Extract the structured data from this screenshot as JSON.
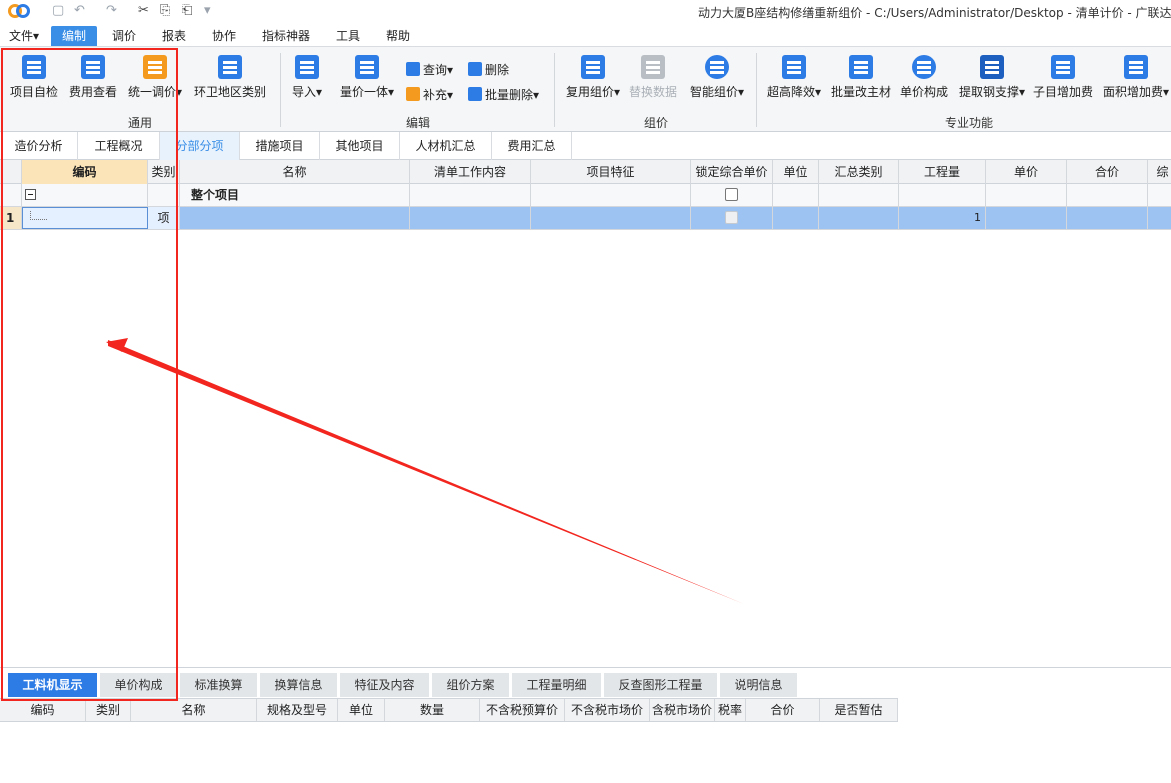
{
  "window": {
    "title": "动力大厦B座结构修缮重新组价 - C:/Users/Administrator/Desktop - 清单计价 - 广联达"
  },
  "quick_access": [
    "▢",
    "↶",
    "↷",
    "✂",
    "⎘",
    "⎗",
    "▾"
  ],
  "menu": [
    {
      "label": "文件▾"
    },
    {
      "label": "编制"
    },
    {
      "label": "调价"
    },
    {
      "label": "报表"
    },
    {
      "label": "协作"
    },
    {
      "label": "指标神器"
    },
    {
      "label": "工具"
    },
    {
      "label": "帮助"
    }
  ],
  "ribbon": {
    "groups": [
      {
        "label": "通用"
      },
      {
        "label": "编辑"
      },
      {
        "label": "组价"
      },
      {
        "label": "专业功能"
      }
    ],
    "buttons": {
      "xmzj": "项目自检",
      "fycx": "费用查看",
      "tytj": "统一调价▾",
      "hwdqlb": "环卫地区类别",
      "daoru": "导入▾",
      "ljyt": "量价一体▾",
      "chaxun": "查询▾",
      "buchong": "补充▾",
      "shanchu": "删除",
      "plsc": "批量删除▾",
      "fyzj": "复用组价▾",
      "thsj": "替换数据",
      "znzj": "智能组价▾",
      "cgjx": "超高降效▾",
      "plgzc": "批量改主材",
      "djgc": "单价构成",
      "tqgzc": "提取钢支撑▾",
      "zmzjf": "子目增加费",
      "mjzjf": "面积增加费▾"
    }
  },
  "tabs": [
    "造价分析",
    "工程概况",
    "分部分项",
    "措施项目",
    "其他项目",
    "人材机汇总",
    "费用汇总"
  ],
  "grid": {
    "columns": [
      "编码",
      "类别",
      "名称",
      "清单工作内容",
      "项目特征",
      "锁定综合单价",
      "单位",
      "汇总类别",
      "工程量",
      "单价",
      "合价",
      "综"
    ],
    "rows": [
      {
        "index": "",
        "code": "",
        "type": "",
        "name": "整个项目",
        "quantity": ""
      },
      {
        "index": "1",
        "code": "",
        "type": "项",
        "name": "",
        "quantity": "1"
      }
    ]
  },
  "bottom_tabs": [
    "工料机显示",
    "单价构成",
    "标准换算",
    "换算信息",
    "特征及内容",
    "组价方案",
    "工程量明细",
    "反查图形工程量",
    "说明信息"
  ],
  "bottom_grid": {
    "columns": [
      "编码",
      "类别",
      "名称",
      "规格及型号",
      "单位",
      "数量",
      "不含税预算价",
      "不含税市场价",
      "含税市场价",
      "税率",
      "合价",
      "是否暂估"
    ]
  },
  "colors": {
    "accent": "#3a8ee6",
    "selected_row": "#9cc3f2",
    "annotation": "#f2261f"
  }
}
